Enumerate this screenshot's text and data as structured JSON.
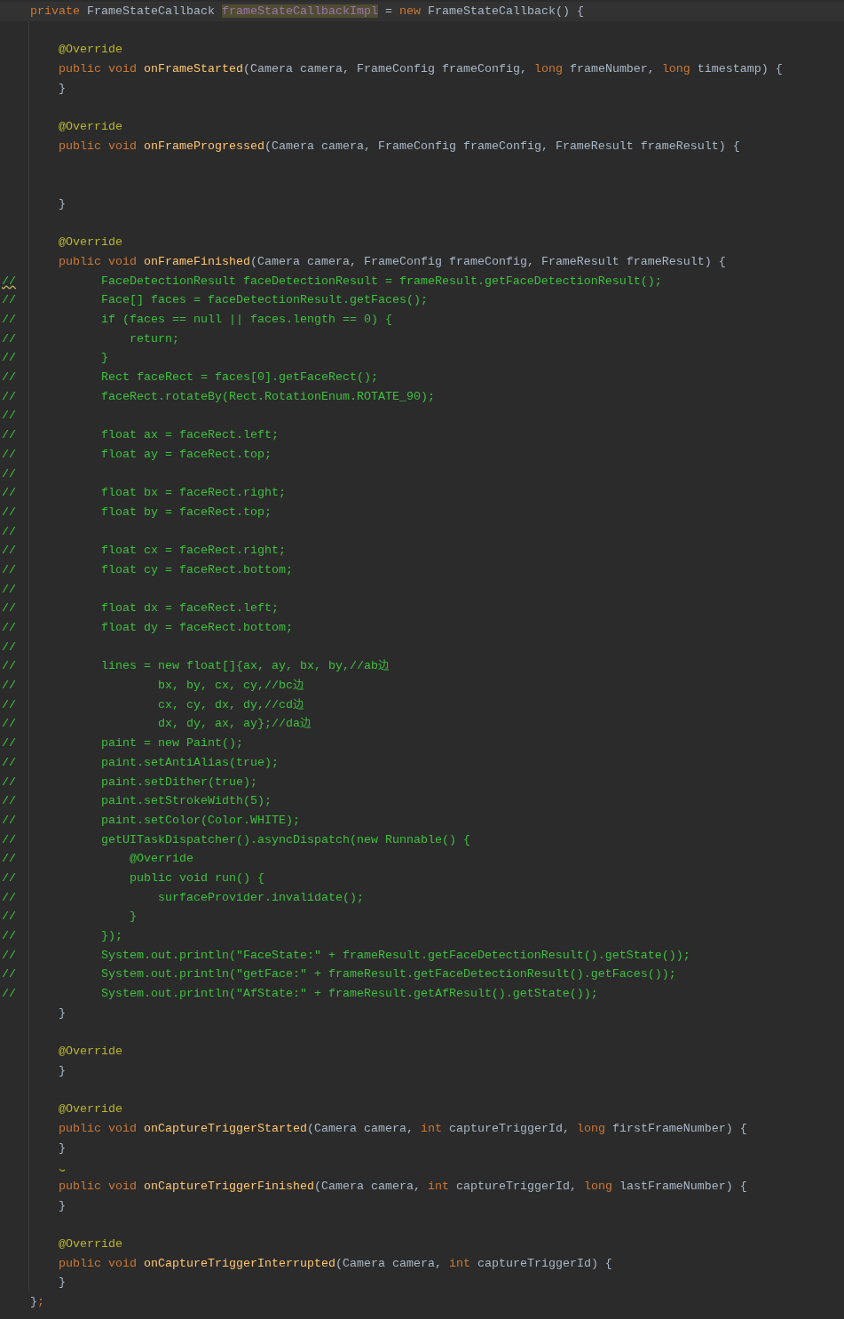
{
  "editor": {
    "lines": [
      {
        "kind": "code",
        "current": true,
        "segments": [
          {
            "text": "    private",
            "kind": "keyword"
          },
          {
            "text": " FrameStateCallback ",
            "kind": "plain"
          },
          {
            "text": "frameStateCallbackImpl",
            "kind": "field"
          },
          {
            "text": " = ",
            "kind": "plain"
          },
          {
            "text": "new",
            "kind": "keyword"
          },
          {
            "text": " FrameStateCallback() {",
            "kind": "plain"
          }
        ]
      },
      {
        "kind": "blank"
      },
      {
        "kind": "code",
        "segments": [
          {
            "text": "        @Override",
            "kind": "annotation"
          }
        ]
      },
      {
        "kind": "code",
        "segments": [
          {
            "text": "        public void ",
            "kind": "keyword"
          },
          {
            "text": "onFrameStarted",
            "kind": "method"
          },
          {
            "text": "(Camera camera, FrameConfig frameConfig, ",
            "kind": "plain"
          },
          {
            "text": "long",
            "kind": "keyword"
          },
          {
            "text": " frameNumber, ",
            "kind": "plain"
          },
          {
            "text": "long",
            "kind": "keyword"
          },
          {
            "text": " timestamp) {",
            "kind": "plain"
          }
        ]
      },
      {
        "kind": "code",
        "segments": [
          {
            "text": "        }",
            "kind": "plain"
          }
        ]
      },
      {
        "kind": "blank"
      },
      {
        "kind": "code",
        "segments": [
          {
            "text": "        @Override",
            "kind": "annotation"
          }
        ]
      },
      {
        "kind": "code",
        "segments": [
          {
            "text": "        public void ",
            "kind": "keyword"
          },
          {
            "text": "onFrameProgressed",
            "kind": "method"
          },
          {
            "text": "(Camera camera, FrameConfig frameConfig, FrameResult frameResult) {",
            "kind": "plain"
          }
        ]
      },
      {
        "kind": "blank"
      },
      {
        "kind": "blank"
      },
      {
        "kind": "code",
        "segments": [
          {
            "text": "        }",
            "kind": "plain"
          }
        ]
      },
      {
        "kind": "blank"
      },
      {
        "kind": "code",
        "segments": [
          {
            "text": "        @Override",
            "kind": "annotation"
          }
        ]
      },
      {
        "kind": "code",
        "segments": [
          {
            "text": "        public void ",
            "kind": "keyword"
          },
          {
            "text": "onFrameFinished",
            "kind": "method"
          },
          {
            "text": "(Camera camera, FrameConfig frameConfig, FrameResult frameResult) {",
            "kind": "plain"
          }
        ]
      },
      {
        "kind": "comment",
        "segments": [
          {
            "text": "//",
            "kind": "comment",
            "warning": true
          },
          {
            "text": "            FaceDetectionResult faceDetectionResult = frameResult.getFaceDetectionResult();",
            "kind": "comment"
          }
        ]
      },
      {
        "kind": "comment",
        "segments": [
          {
            "text": "//            Face[] faces = faceDetectionResult.getFaces();",
            "kind": "comment"
          }
        ]
      },
      {
        "kind": "comment",
        "segments": [
          {
            "text": "//            if (faces == null || faces.length == 0) {",
            "kind": "comment"
          }
        ]
      },
      {
        "kind": "comment",
        "segments": [
          {
            "text": "//                return;",
            "kind": "comment"
          }
        ]
      },
      {
        "kind": "comment",
        "segments": [
          {
            "text": "//            }",
            "kind": "comment"
          }
        ]
      },
      {
        "kind": "comment",
        "segments": [
          {
            "text": "//            Rect faceRect = faces[0].getFaceRect();",
            "kind": "comment"
          }
        ]
      },
      {
        "kind": "comment",
        "segments": [
          {
            "text": "//            faceRect.rotateBy(Rect.RotationEnum.ROTATE_90);",
            "kind": "comment"
          }
        ]
      },
      {
        "kind": "comment",
        "segments": [
          {
            "text": "//",
            "kind": "comment"
          }
        ]
      },
      {
        "kind": "comment",
        "segments": [
          {
            "text": "//            float ax = faceRect.left;",
            "kind": "comment"
          }
        ]
      },
      {
        "kind": "comment",
        "segments": [
          {
            "text": "//            float ay = faceRect.top;",
            "kind": "comment"
          }
        ]
      },
      {
        "kind": "comment",
        "segments": [
          {
            "text": "//",
            "kind": "comment"
          }
        ]
      },
      {
        "kind": "comment",
        "segments": [
          {
            "text": "//            float bx = faceRect.right;",
            "kind": "comment"
          }
        ]
      },
      {
        "kind": "comment",
        "segments": [
          {
            "text": "//            float by = faceRect.top;",
            "kind": "comment"
          }
        ]
      },
      {
        "kind": "comment",
        "segments": [
          {
            "text": "//",
            "kind": "comment"
          }
        ]
      },
      {
        "kind": "comment",
        "segments": [
          {
            "text": "//            float cx = faceRect.right;",
            "kind": "comment"
          }
        ]
      },
      {
        "kind": "comment",
        "segments": [
          {
            "text": "//            float cy = faceRect.bottom;",
            "kind": "comment"
          }
        ]
      },
      {
        "kind": "comment",
        "segments": [
          {
            "text": "//",
            "kind": "comment"
          }
        ]
      },
      {
        "kind": "comment",
        "segments": [
          {
            "text": "//            float dx = faceRect.left;",
            "kind": "comment"
          }
        ]
      },
      {
        "kind": "comment",
        "segments": [
          {
            "text": "//            float dy = faceRect.bottom;",
            "kind": "comment"
          }
        ]
      },
      {
        "kind": "comment",
        "segments": [
          {
            "text": "//",
            "kind": "comment"
          }
        ]
      },
      {
        "kind": "comment",
        "segments": [
          {
            "text": "//            lines = new float[]{ax, ay, bx, by,//ab边",
            "kind": "comment"
          }
        ]
      },
      {
        "kind": "comment",
        "segments": [
          {
            "text": "//                    bx, by, cx, cy,//bc边",
            "kind": "comment"
          }
        ]
      },
      {
        "kind": "comment",
        "segments": [
          {
            "text": "//                    cx, cy, dx, dy,//cd边",
            "kind": "comment"
          }
        ]
      },
      {
        "kind": "comment",
        "segments": [
          {
            "text": "//                    dx, dy, ax, ay};//da边",
            "kind": "comment"
          }
        ]
      },
      {
        "kind": "comment",
        "segments": [
          {
            "text": "//            paint = new Paint();",
            "kind": "comment"
          }
        ]
      },
      {
        "kind": "comment",
        "segments": [
          {
            "text": "//            paint.setAntiAlias(true);",
            "kind": "comment"
          }
        ]
      },
      {
        "kind": "comment",
        "segments": [
          {
            "text": "//            paint.setDither(true);",
            "kind": "comment"
          }
        ]
      },
      {
        "kind": "comment",
        "segments": [
          {
            "text": "//            paint.setStrokeWidth(5);",
            "kind": "comment"
          }
        ]
      },
      {
        "kind": "comment",
        "segments": [
          {
            "text": "//            paint.setColor(Color.WHITE);",
            "kind": "comment"
          }
        ]
      },
      {
        "kind": "comment",
        "segments": [
          {
            "text": "//            getUITaskDispatcher().asyncDispatch(new Runnable() {",
            "kind": "comment"
          }
        ]
      },
      {
        "kind": "comment",
        "segments": [
          {
            "text": "//                @Override",
            "kind": "comment"
          }
        ]
      },
      {
        "kind": "comment",
        "segments": [
          {
            "text": "//                public void run() {",
            "kind": "comment"
          }
        ]
      },
      {
        "kind": "comment",
        "segments": [
          {
            "text": "//                    surfaceProvider.invalidate();",
            "kind": "comment"
          }
        ]
      },
      {
        "kind": "comment",
        "segments": [
          {
            "text": "//                }",
            "kind": "comment"
          }
        ]
      },
      {
        "kind": "comment",
        "segments": [
          {
            "text": "//            });",
            "kind": "comment"
          }
        ]
      },
      {
        "kind": "comment",
        "segments": [
          {
            "text": "//            System.out.println(\"FaceState:\" + frameResult.getFaceDetectionResult().getState());",
            "kind": "comment"
          }
        ]
      },
      {
        "kind": "comment",
        "segments": [
          {
            "text": "//            System.out.println(\"getFace:\" + frameResult.getFaceDetectionResult().getFaces());",
            "kind": "comment"
          }
        ]
      },
      {
        "kind": "comment",
        "segments": [
          {
            "text": "//            System.out.println(\"AfState:\" + frameResult.getAfResult().getState());",
            "kind": "comment"
          }
        ]
      },
      {
        "kind": "code",
        "segments": [
          {
            "text": "        }",
            "kind": "plain"
          }
        ]
      },
      {
        "kind": "blank"
      },
      {
        "kind": "code",
        "segments": [
          {
            "text": "        @Override",
            "kind": "annotation"
          }
        ]
      },
      {
        "kind": "code",
        "segments": [
          {
            "text": "        }",
            "kind": "plain"
          }
        ]
      },
      {
        "kind": "blank"
      },
      {
        "kind": "code",
        "segments": [
          {
            "text": "        @Override",
            "kind": "annotation"
          }
        ]
      },
      {
        "kind": "code",
        "segments": [
          {
            "text": "        public void ",
            "kind": "keyword"
          },
          {
            "text": "onCaptureTriggerStarted",
            "kind": "method"
          },
          {
            "text": "(Camera camera, ",
            "kind": "plain"
          },
          {
            "text": "int",
            "kind": "keyword"
          },
          {
            "text": " captureTriggerId, ",
            "kind": "plain"
          },
          {
            "text": "long",
            "kind": "keyword"
          },
          {
            "text": " firstFrameNumber) {",
            "kind": "plain"
          }
        ]
      },
      {
        "kind": "code",
        "segments": [
          {
            "text": "        }",
            "kind": "plain"
          }
        ]
      },
      {
        "kind": "fold"
      },
      {
        "kind": "code",
        "segments": [
          {
            "text": "        public void ",
            "kind": "keyword"
          },
          {
            "text": "onCaptureTriggerFinished",
            "kind": "method"
          },
          {
            "text": "(Camera camera, ",
            "kind": "plain"
          },
          {
            "text": "int",
            "kind": "keyword"
          },
          {
            "text": " captureTriggerId, ",
            "kind": "plain"
          },
          {
            "text": "long",
            "kind": "keyword"
          },
          {
            "text": " lastFrameNumber) {",
            "kind": "plain"
          }
        ]
      },
      {
        "kind": "code",
        "segments": [
          {
            "text": "        }",
            "kind": "plain"
          }
        ]
      },
      {
        "kind": "blank"
      },
      {
        "kind": "code",
        "segments": [
          {
            "text": "        @Override",
            "kind": "annotation"
          }
        ]
      },
      {
        "kind": "code",
        "segments": [
          {
            "text": "        public void ",
            "kind": "keyword"
          },
          {
            "text": "onCaptureTriggerInterrupted",
            "kind": "method"
          },
          {
            "text": "(Camera camera, ",
            "kind": "plain"
          },
          {
            "text": "int",
            "kind": "keyword"
          },
          {
            "text": " captureTriggerId) {",
            "kind": "plain"
          }
        ]
      },
      {
        "kind": "code",
        "segments": [
          {
            "text": "        }",
            "kind": "plain"
          }
        ]
      },
      {
        "kind": "code",
        "segments": [
          {
            "text": "    }",
            "kind": "plain"
          },
          {
            "text": ";",
            "kind": "keyword"
          }
        ]
      }
    ]
  }
}
